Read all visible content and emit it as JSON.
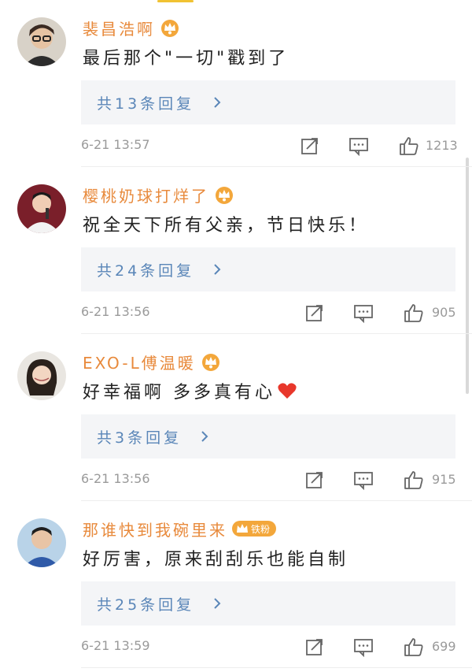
{
  "colors": {
    "username": "#e88a3c",
    "reply_link": "#5a86b8",
    "reply_bg": "#f4f5f7",
    "meta": "#9a9a9a",
    "heart": "#e8372b",
    "badge": "#f3a73b"
  },
  "comments": [
    {
      "username": "裴昌浩啊",
      "text": "最后那个\"一切\"戳到了",
      "reply_label": "共13条回复",
      "timestamp": "6-21 13:57",
      "likes": "1213",
      "avatar_icon": "avatar-man-glasses",
      "badge_icon": "crown-icon"
    },
    {
      "username": "樱桃奶球打烊了",
      "text": "祝全天下所有父亲，节日快乐！",
      "reply_label": "共24条回复",
      "timestamp": "6-21 13:56",
      "likes": "905",
      "avatar_icon": "avatar-performer",
      "badge_icon": "crown-icon"
    },
    {
      "username": "EXO-L傅温暖",
      "text": "好幸福啊 多多真有心",
      "reply_label": "共3条回复",
      "timestamp": "6-21 13:56",
      "likes": "915",
      "avatar_icon": "avatar-woman",
      "badge_icon": "crown-icon",
      "emoji": "heart-icon"
    },
    {
      "username": "那谁快到我碗里来",
      "text": "好厉害，原来刮刮乐也能自制",
      "reply_label": "共25条回复",
      "timestamp": "6-21 13:59",
      "likes": "699",
      "avatar_icon": "avatar-man-blue",
      "badge_icon": "crown-icon",
      "badge_text": "铁粉"
    }
  ]
}
